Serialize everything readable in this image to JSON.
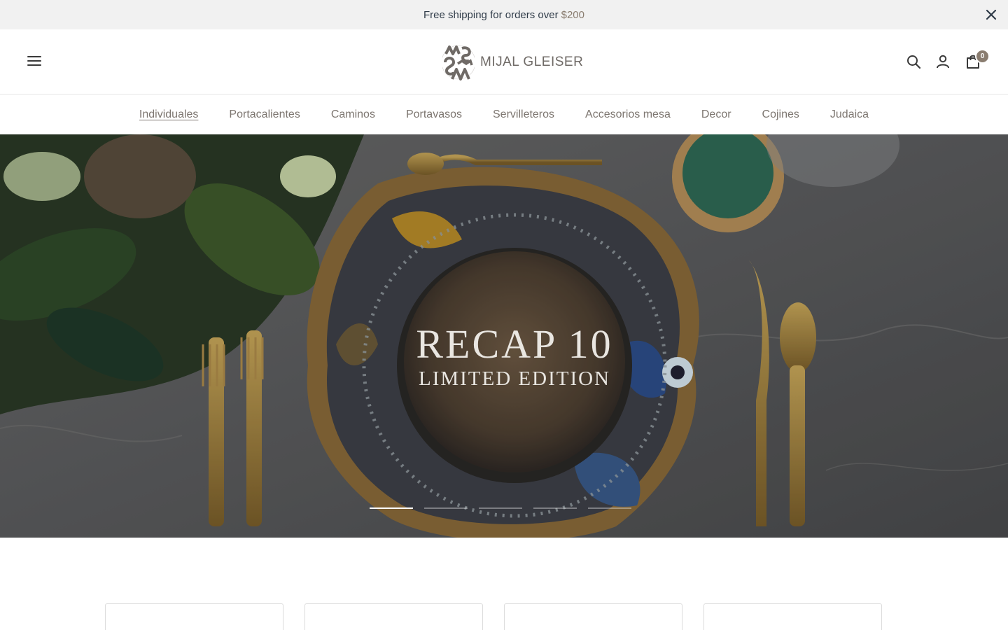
{
  "announcement": {
    "text": "Free shipping for orders over",
    "amount": "$200"
  },
  "header": {
    "logo_text": "MIJAL GLEISER",
    "cart_count": "0",
    "icons": [
      "menu-icon",
      "search-icon",
      "account-icon",
      "cart-icon",
      "close-icon"
    ]
  },
  "nav": {
    "items": [
      {
        "label": "Individuales"
      },
      {
        "label": "Portacalientes"
      },
      {
        "label": "Caminos"
      },
      {
        "label": "Portavasos"
      },
      {
        "label": "Servilleteros"
      },
      {
        "label": "Accesorios mesa"
      },
      {
        "label": "Decor"
      },
      {
        "label": "Cojines"
      },
      {
        "label": "Judaica"
      }
    ]
  },
  "hero": {
    "title": "RECAP 10",
    "subtitle": "LIMITED EDITION",
    "slide_count": 5,
    "active_slide": 1
  },
  "colors": {
    "accent": "#8a7d70",
    "announce_bg": "#f1f1f1",
    "nav_text": "#7d7670"
  }
}
